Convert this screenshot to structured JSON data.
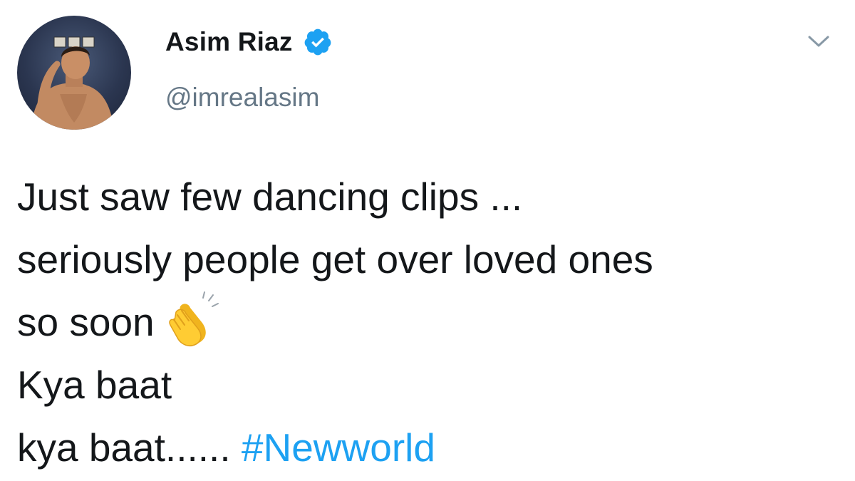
{
  "tweet": {
    "author": {
      "display_name": "Asim Riaz",
      "handle": "@imrealasim",
      "verified": true,
      "avatar": "profile-photo"
    },
    "menu_icon": "chevron-down-icon",
    "lines": {
      "l1": "Just saw few dancing clips ...",
      "l2": "seriously people get over loved ones",
      "l3": "so soon",
      "l4": "Kya baat",
      "l5_text": "kya baat...... ",
      "l5_hashtag": "#Newworld"
    },
    "emoji": "clapping-hands-emoji"
  },
  "colors": {
    "text": "#14171a",
    "muted": "#657786",
    "link": "#1da1f2",
    "verified": "#1da1f2",
    "background": "#ffffff"
  }
}
